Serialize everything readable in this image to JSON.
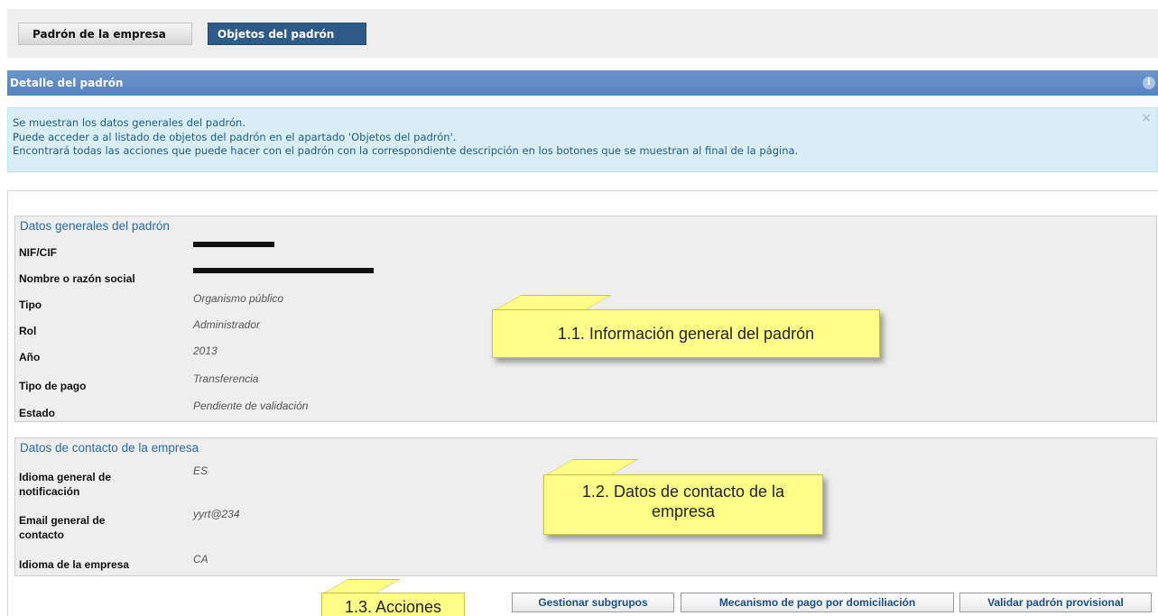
{
  "tabs": [
    {
      "label": "Padrón de la empresa"
    },
    {
      "label": "Objetos del padrón"
    }
  ],
  "panel": {
    "title": "Detalle del padrón",
    "info_icon": "info-icon"
  },
  "alert": {
    "lines": [
      "Se muestran los datos generales del padrón.",
      "Puede acceder a al listado de objetos del padrón en el apartado 'Objetos del padrón'.",
      "Encontrará todas las acciones que puede hacer con el padrón con la correspondiente descripción en los botones que se muestran al final de la página."
    ],
    "close": "×"
  },
  "general": {
    "legend": "Datos generales del padrón",
    "fields": [
      {
        "label": "NIF/CIF",
        "value": ""
      },
      {
        "label": "Nombre o razón social",
        "value": ""
      },
      {
        "label": "Tipo",
        "value": "Organismo público"
      },
      {
        "label": "Rol",
        "value": "Administrador"
      },
      {
        "label": "Año",
        "value": "2013"
      },
      {
        "label": "Tipo de pago",
        "value": "Transferencia"
      },
      {
        "label": "Estado",
        "value": "Pendiente de validación"
      }
    ]
  },
  "contact": {
    "legend": "Datos de contacto de la empresa",
    "fields": [
      {
        "label": "Idioma general de notificación",
        "value": "ES"
      },
      {
        "label": "Email general de contacto",
        "value": "yyrt@234"
      },
      {
        "label": "Idioma de la empresa",
        "value": "CA"
      }
    ]
  },
  "notes": [
    {
      "text": "1.1. Información general del padrón"
    },
    {
      "text": "1.2. Datos de contacto de la empresa"
    },
    {
      "text": "1.3. Acciones"
    }
  ],
  "actions": [
    {
      "label": "Gestionar subgrupos"
    },
    {
      "label": "Mecanismo de pago por domiciliación"
    },
    {
      "label": "Validar padrón provisional"
    }
  ]
}
